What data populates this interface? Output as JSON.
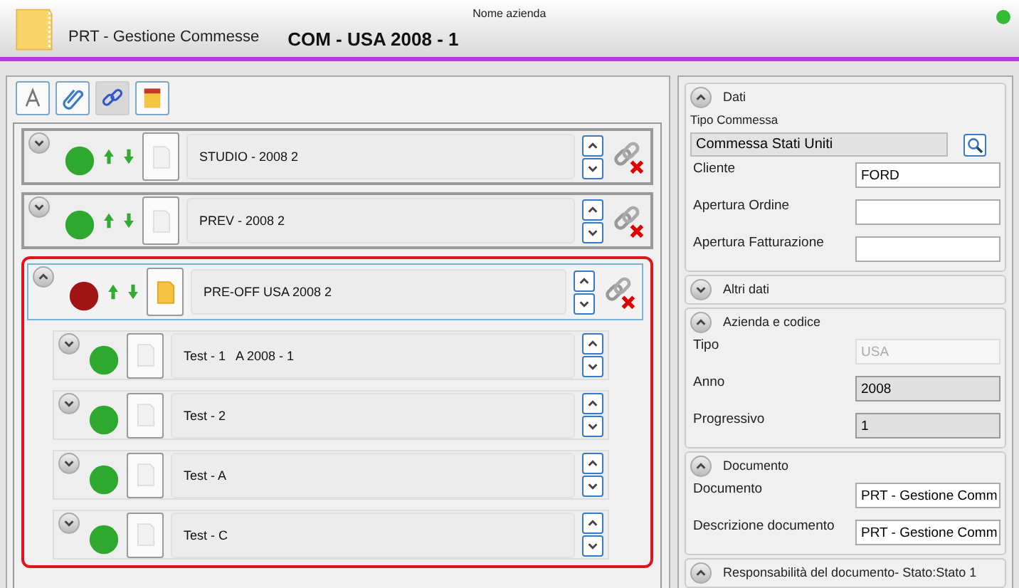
{
  "header": {
    "app_title": "PRT - Gestione Commesse",
    "company_label": "Nome azienda",
    "record_title": "COM - USA 2008 - 1",
    "online": true
  },
  "items": [
    {
      "name": "STUDIO - 2008 2",
      "color": "#2fa82f",
      "expanded": false,
      "selected": false,
      "note": false
    },
    {
      "name": "PREV - 2008 2",
      "color": "#2fa82f",
      "expanded": false,
      "selected": false,
      "note": false
    },
    {
      "name": "PRE-OFF USA 2008 2",
      "color": "#a01414",
      "expanded": true,
      "selected": true,
      "note": true,
      "children": [
        {
          "name": "Test - 1   A 2008 - 1",
          "color": "#2fa82f",
          "expanded": false,
          "selected": false,
          "note": false
        },
        {
          "name": "Test - 2",
          "color": "#2fa82f",
          "expanded": false,
          "selected": false,
          "note": false
        },
        {
          "name": "Test - A",
          "color": "#2fa82f",
          "expanded": false,
          "selected": false,
          "note": false
        },
        {
          "name": "Test - C",
          "color": "#2fa82f",
          "expanded": false,
          "selected": false,
          "note": false
        }
      ]
    }
  ],
  "sections": [
    {
      "title": "Dati",
      "expanded": true,
      "fields": [
        {
          "kind": "lookup",
          "label": "Tipo Commessa",
          "value": "Commessa Stati Uniti"
        },
        {
          "kind": "text",
          "label": "Cliente",
          "value": "FORD"
        },
        {
          "kind": "text",
          "label": "Apertura Ordine"
        },
        {
          "kind": "text",
          "label": "Apertura Fatturazione"
        }
      ]
    },
    {
      "title": "Altri dati",
      "expanded": false
    },
    {
      "title": "Azienda e codice",
      "expanded": true,
      "fields": [
        {
          "kind": "disabled",
          "label": "Tipo",
          "value": "USA"
        },
        {
          "kind": "readonly",
          "label": "Anno",
          "value": "2008"
        },
        {
          "kind": "readonly",
          "label": "Progressivo",
          "value": "1"
        }
      ]
    },
    {
      "title": "Documento",
      "expanded": true,
      "fields": [
        {
          "kind": "text",
          "label": "Documento",
          "value": "PRT - Gestione Comm"
        },
        {
          "kind": "text",
          "label": "Descrizione documento",
          "value": "PRT - Gestione Comm"
        }
      ]
    },
    {
      "title": "Responsabilità del documento- Stato:Stato 1",
      "expanded": true
    }
  ]
}
